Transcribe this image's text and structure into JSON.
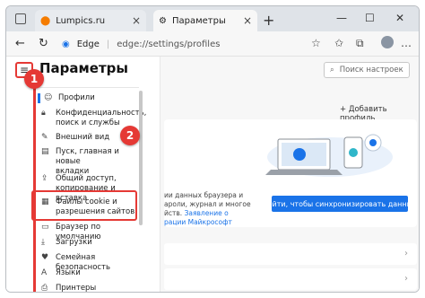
{
  "tabs": [
    {
      "label": "Lumpics.ru",
      "close": "×"
    },
    {
      "label": "Параметры",
      "close": "×"
    }
  ],
  "newtab_label": "+",
  "window_controls": [
    "—",
    "☐",
    "✕"
  ],
  "address": {
    "site": "Edge",
    "url": "edge://settings/profiles"
  },
  "sidebar": {
    "title": "Параметры",
    "items": [
      {
        "label1": "Профили",
        "label2": "",
        "icon": "person-icon"
      },
      {
        "label1": "Конфиденциальность,",
        "label2": "поиск и службы",
        "icon": "lock-icon"
      },
      {
        "label1": "Внешний вид",
        "label2": "",
        "icon": "brush-icon"
      },
      {
        "label1": "Пуск, главная и новые",
        "label2": "вкладки",
        "icon": "start-page-icon"
      },
      {
        "label1": "Общий доступ,",
        "label2": "копирование и вставка",
        "icon": "share-icon"
      },
      {
        "label1": "Файлы cookie и",
        "label2": "разрешения сайтов",
        "icon": "cookie-icon"
      },
      {
        "label1": "Браузер по умолчанию",
        "label2": "",
        "icon": "browser-icon"
      },
      {
        "label1": "Загрузки",
        "label2": "",
        "icon": "download-icon"
      },
      {
        "label1": "Семейная безопасность",
        "label2": "",
        "icon": "family-icon"
      },
      {
        "label1": "Языки",
        "label2": "",
        "icon": "language-icon"
      },
      {
        "label1": "Принтеры",
        "label2": "",
        "icon": "printer-icon"
      }
    ]
  },
  "search": {
    "placeholder": "Поиск настроек"
  },
  "main": {
    "add_profile": "Добавить профиль",
    "sync_text_line1": "ии данных браузера и",
    "sync_text_line2": "ароли, журнал и многое",
    "sync_text_line3": "йств.",
    "sync_text_link1": "Заявление о",
    "sync_text_link2": "рации Майкрософт",
    "sync_button": "Войти, чтобы синхронизировать данные"
  },
  "badges": {
    "one": "1",
    "two": "2"
  },
  "colors": {
    "accent": "#1a73e8",
    "highlight": "#e53935"
  }
}
